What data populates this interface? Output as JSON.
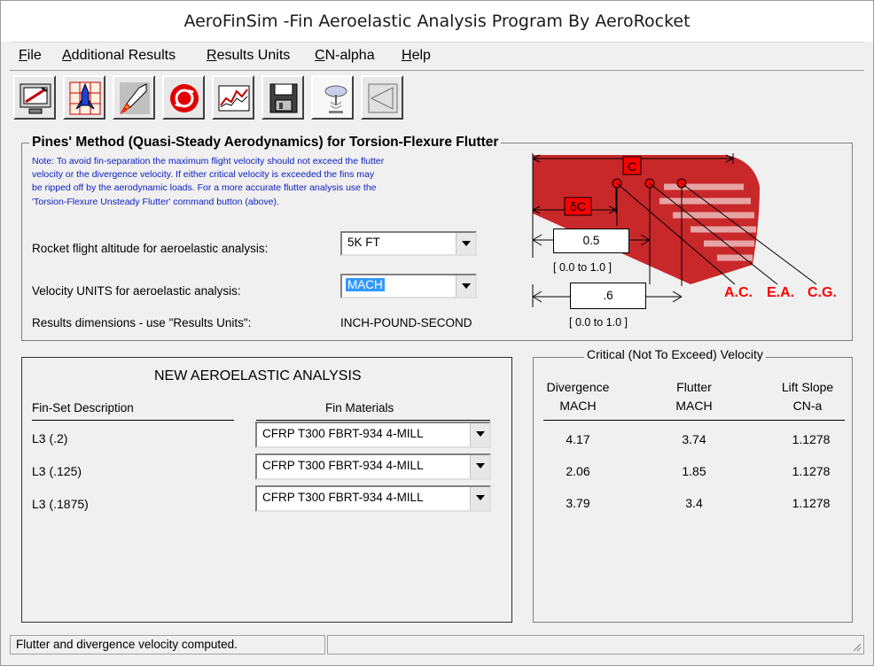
{
  "window": {
    "title": "AeroFinSim -Fin Aeroelastic Analysis Program By AeroRocket"
  },
  "menu": [
    {
      "label": "File",
      "u": "F",
      "rest": "ile"
    },
    {
      "label": "Additional Results",
      "u": "A",
      "rest": "dditional Results"
    },
    {
      "label": "Results Units",
      "u": "R",
      "rest": "esults Units"
    },
    {
      "label": "CN-alpha",
      "u": "C",
      "rest": "N-alpha"
    },
    {
      "label": "Help",
      "u": "H",
      "rest": "elp"
    }
  ],
  "toolbar": {
    "buttons": [
      "monitor-icon",
      "rocket-icon",
      "rocket-flame-icon",
      "refresh-icon",
      "chart-icon",
      "save-icon",
      "flutter-icon",
      "fin-icon"
    ]
  },
  "pines": {
    "title": "Pines' Method (Quasi-Steady Aerodynamics) for Torsion-Flexure Flutter",
    "note_lines": [
      "Note: To avoid fin-separation the maximum flight velocity should not exceed the flutter",
      "velocity or the divergence velocity. If either critical velocity is exceeded the fins may",
      "be ripped off by the aerodynamic loads. For a more accurate flutter analysis use the",
      "'Torsion-Flexure Unsteady Flutter' command button (above)."
    ],
    "altitude_label": "Rocket flight altitude for aeroelastic analysis:",
    "altitude_value": "5K FT",
    "velocity_units_label": "Velocity UNITS for aeroelastic analysis:",
    "velocity_units_value": "MACH",
    "results_dims_label": "Results dimensions - use \"Results Units\":",
    "results_dims_value": "INCH-POUND-SECOND"
  },
  "diagram": {
    "c_label": "C",
    "dc_label": "δC",
    "ea_value": "0.5",
    "ea_range": "[ 0.0 to 1.0 ]",
    "cg_value": ".6",
    "cg_range": "[ 0.0 to 1.0 ]",
    "ac_label": "A.C.",
    "ea_label": "E.A.",
    "cg_label": "C.G.",
    "colors": {
      "fin_red": "#c8282a",
      "fin_stripe": "#e7a4a4",
      "marker": "#ff0000"
    }
  },
  "analysis": {
    "title": "NEW AEROELASTIC ANALYSIS",
    "col_description": "Fin-Set Description",
    "col_materials": "Fin Materials",
    "rows": [
      {
        "description": "L3 (.2)",
        "material": "CFRP T300 FBRT-934 4-MILL"
      },
      {
        "description": "L3 (.125)",
        "material": "CFRP T300 FBRT-934 4-MILL"
      },
      {
        "description": "L3 (.1875)",
        "material": "CFRP T300 FBRT-934 4-MILL"
      }
    ]
  },
  "critical": {
    "title": "Critical (Not To Exceed) Velocity",
    "headers": [
      {
        "line1": "Divergence",
        "line2": "MACH"
      },
      {
        "line1": "Flutter",
        "line2": "MACH"
      },
      {
        "line1": "Lift Slope",
        "line2": "CN-a"
      }
    ],
    "rows": [
      [
        "4.17",
        "3.74",
        "1.1278"
      ],
      [
        "2.06",
        "1.85",
        "1.1278"
      ],
      [
        "3.79",
        "3.4",
        "1.1278"
      ]
    ]
  },
  "status": {
    "message": "Flutter and divergence velocity computed."
  }
}
